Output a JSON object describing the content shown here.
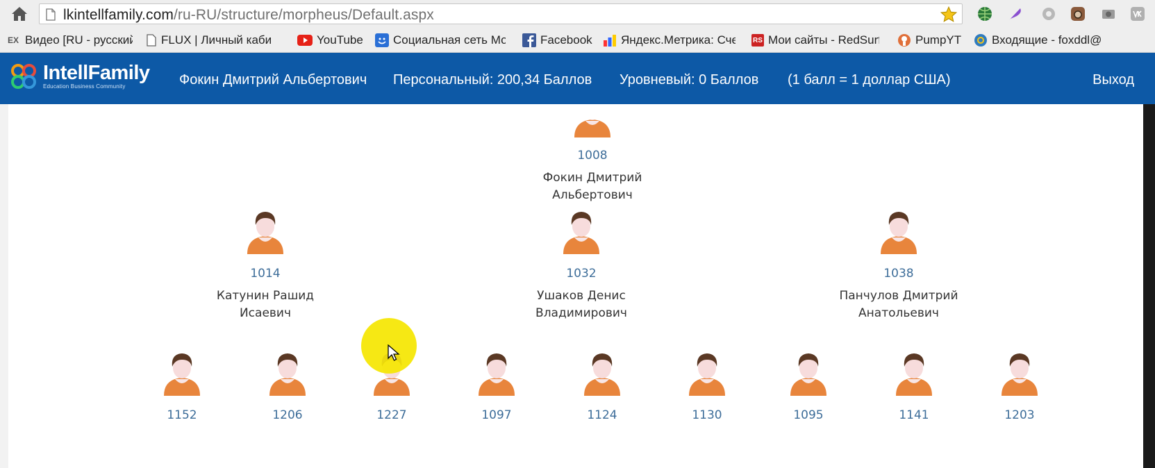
{
  "browser": {
    "url_host": "lkintellfamily.com",
    "url_path": "/ru-RU/structure/morpheus/Default.aspx",
    "bookmarks": [
      {
        "label": "Видео [RU - русский]",
        "icon": "ex-icon",
        "color": "#666666"
      },
      {
        "label": "FLUX | Личный кабин",
        "icon": "page-icon",
        "color": "#888888"
      },
      {
        "label": "YouTube",
        "icon": "youtube-icon",
        "color": "#e62117"
      },
      {
        "label": "Социальная сеть Мо",
        "icon": "social-icon",
        "color": "#2a6fd6"
      },
      {
        "label": "Facebook",
        "icon": "facebook-icon",
        "color": "#3b5998"
      },
      {
        "label": "Яндекс.Метрика: Сче",
        "icon": "metrika-icon",
        "color": "#ffcc00"
      },
      {
        "label": "Мои сайты - RedSurf",
        "icon": "redsurf-icon",
        "color": "#cc2222"
      },
      {
        "label": "PumpYT",
        "icon": "pumpyt-icon",
        "color": "#e0703a"
      },
      {
        "label": "Входящие - foxddl@",
        "icon": "mail-icon",
        "color": "#2f7bbf"
      }
    ],
    "bookmark_fav_text": {
      "ex": "EX",
      "rs": "RS"
    }
  },
  "header": {
    "logo": "IntellFamily",
    "logo_sub": "Education Business Community",
    "user": "Фокин Дмитрий Альбертович",
    "personal": "Персональный: 200,34 Баллов",
    "level": "Уровневый: 0 Баллов",
    "rate": "(1 балл = 1 доллар США)",
    "logout": "Выход",
    "bg_color": "#0d59a6"
  },
  "tree": {
    "root": {
      "id": "1008",
      "name_line1": "Фокин Дмитрий",
      "name_line2": "Альбертович"
    },
    "level1": [
      {
        "id": "1014",
        "name_line1": "Катунин Рашид",
        "name_line2": "Исаевич"
      },
      {
        "id": "1032",
        "name_line1": "Ушаков Денис",
        "name_line2": "Владимирович"
      },
      {
        "id": "1038",
        "name_line1": "Панчулов Дмитрий",
        "name_line2": "Анатольевич"
      }
    ],
    "level2": [
      "1152",
      "1206",
      "1227",
      "1097",
      "1124",
      "1130",
      "1095",
      "1141",
      "1203"
    ],
    "link_color": "#3d6d99",
    "avatar_shirt_color": "#e8853c"
  }
}
